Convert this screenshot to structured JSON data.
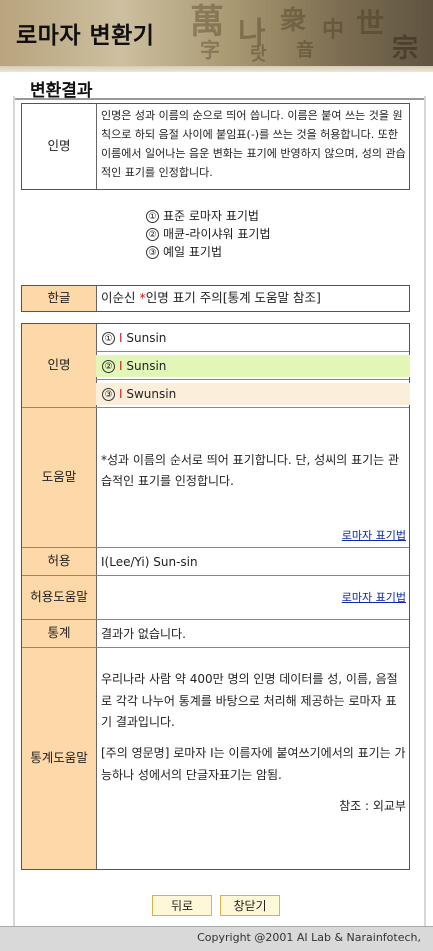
{
  "header": {
    "title": "로마자 변환기"
  },
  "section": {
    "title": "변환결과"
  },
  "intro": {
    "label": "인명",
    "text": "인명은 성과 이름의 순으로 띄어 씁니다. 이름은 붙여 쓰는 것을 원칙으로 하되 음절 사이에 붙임표(-)를 쓰는 것을 허용합니다. 또한 이름에서 일어나는 음운 변화는 표기에 반영하지 않으며, 성의 관습적인 표기를 인정합니다."
  },
  "methods": [
    {
      "num": "①",
      "label": "표준 로마자 표기법"
    },
    {
      "num": "②",
      "label": "매큔-라이샤워 표기법"
    },
    {
      "num": "③",
      "label": "예일 표기법"
    }
  ],
  "hangul": {
    "label": "한글",
    "value": "이순신",
    "star": "*",
    "note": "인명 표기 주의[통계 도움말 참조]"
  },
  "result": {
    "name_label": "인명",
    "rows": [
      {
        "num": "①",
        "initial": "I",
        "rest": " Sunsin",
        "bg": "#ffffff"
      },
      {
        "num": "②",
        "initial": "I",
        "rest": " Sunsin",
        "bg": "#e2f6b8"
      },
      {
        "num": "③",
        "initial": "I",
        "rest": " Swunsin",
        "bg": "#fbeedb"
      }
    ],
    "help_label": "도움말",
    "help_text": "*성과 이름의 순서로 띄어 표기합니다. 단, 성씨의 표기는 관습적인 표기를 인정합니다.",
    "help_link": "로마자 표기법",
    "allow_label": "허용",
    "allow_value": "I(Lee/Yi) Sun-sin",
    "allow_help_label": "허용도움말",
    "allow_help_link": "로마자 표기법",
    "stats_label": "통계",
    "stats_value": "결과가 없습니다.",
    "stats_help_label": "통계도움말",
    "stats_help_p1": "우리나라 사람 약 400만 명의 인명 데이터를 성, 이름, 음절로 각각 나누어 통계를 바탕으로 처리해 제공하는 로마자 표기 결과입니다.",
    "stats_help_p2": "[주의 영문명] 로마자 I는 이름자에 붙여쓰기에서의 표기는 가능하나 성에서의 단글자표기는 암됨.",
    "stats_help_ref": "참조 : 외교부"
  },
  "buttons": {
    "back": "뒤로",
    "close": "창닫기"
  },
  "footer": {
    "copyright": "Copyright @2001 AI Lab & Narainfotech,"
  },
  "colors": {
    "label_bg": "#fdd8a8",
    "accent_red": "#d01818",
    "link": "#0a2aa8"
  }
}
